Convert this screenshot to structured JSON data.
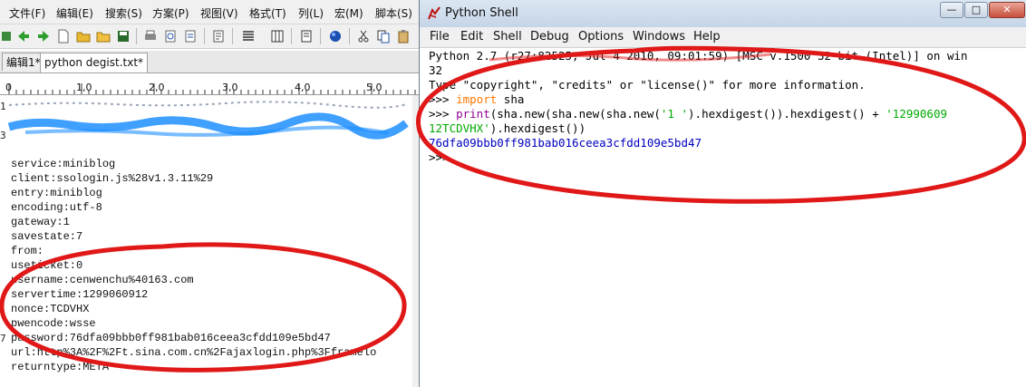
{
  "editor": {
    "menu": [
      "文件(F)",
      "编辑(E)",
      "搜索(S)",
      "方案(P)",
      "视图(V)",
      "格式(T)",
      "列(L)",
      "宏(M)",
      "脚本(S)"
    ],
    "tabs": [
      "编辑1*",
      "python degist.txt*"
    ],
    "ruler": [
      "0",
      "1,0",
      "2,0",
      "3,0",
      "4,0",
      "5,0"
    ],
    "gutter": [
      "1",
      "3",
      "7"
    ],
    "lines": [
      "service:miniblog",
      "client:ssologin.js%28v1.3.11%29",
      "entry:miniblog",
      "encoding:utf-8",
      "gateway:1",
      "savestate:7",
      "from:",
      "useticket:0",
      "username:cenwenchu%40163.com",
      "servertime:1299060912",
      "nonce:TCDVHX",
      "pwencode:wsse",
      "password:76dfa09bbb0ff981bab016ceea3cfdd109e5bd47",
      "url:http%3A%2F%2Ft.sina.com.cn%2Fajaxlogin.php%3Fframelo",
      "returntype:META"
    ]
  },
  "shell": {
    "title": "Python Shell",
    "window_controls": {
      "minimize": "—",
      "maximize": "□",
      "close": "✕"
    },
    "menu": [
      "File",
      "Edit",
      "Shell",
      "Debug",
      "Options",
      "Windows",
      "Help"
    ],
    "banner_1": "Python 2.7 (r27:82525, Jul  4 2010, 09:01:59) [MSC v.1500 32 bit (Intel)] on win",
    "banner_2": "32",
    "banner_3": "Type \"copyright\", \"credits\" or \"license()\" for more information.",
    "prompt": ">>>",
    "import_kw": "import",
    "import_mod": " sha",
    "cmd_print": "print",
    "cmd_a": "(sha.new(sha.new(sha.new(",
    "cmd_str1": "'1     '",
    "cmd_b": ").hexdigest()).hexdigest() + ",
    "cmd_str2a": "'12990609",
    "cmd_str2b": "12TCDVHX'",
    "cmd_c": ").hexdigest())",
    "output": "76dfa09bbb0ff981bab016ceea3cfdd109e5bd47"
  },
  "colors": {
    "annotation_red": "#e01818",
    "redaction_blue": "#1f8fff",
    "keyword_orange": "#ff7700",
    "builtin_purple": "#900090",
    "string_green": "#00aa00",
    "output_blue": "#0000c0"
  }
}
